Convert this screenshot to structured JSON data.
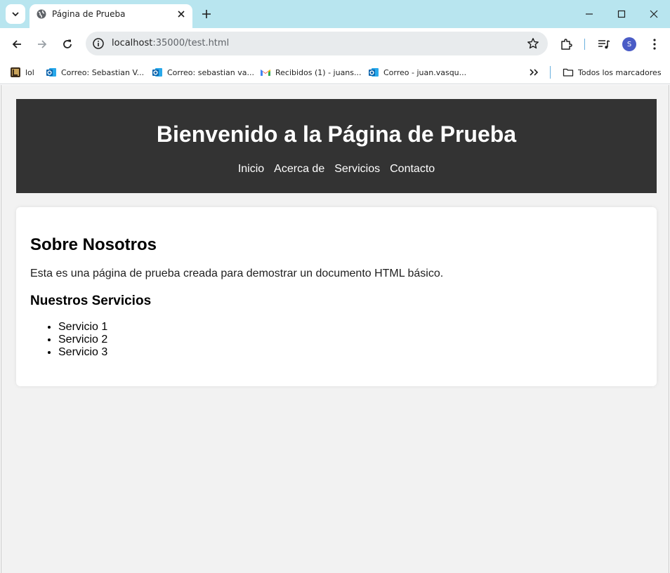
{
  "browser": {
    "tab": {
      "title": "Página de Prueba"
    },
    "address": {
      "host": "localhost",
      "rest": ":35000/test.html"
    },
    "avatar_letter": "S",
    "bookmarks": [
      {
        "label": "lol",
        "icon": "lol-bookmark-icon"
      },
      {
        "label": "Correo: Sebastian V...",
        "icon": "outlook-icon"
      },
      {
        "label": "Correo: sebastian va...",
        "icon": "outlook-icon"
      },
      {
        "label": "Recibidos (1) - juans...",
        "icon": "gmail-icon"
      },
      {
        "label": "Correo - juan.vasqu...",
        "icon": "outlook-icon"
      }
    ],
    "all_bookmarks_label": "Todos los marcadores",
    "colors": {
      "tabstrip": "#b8e5ef",
      "omnibox": "#e8ebed",
      "avatar": "#4a5cc6"
    }
  },
  "page": {
    "header": {
      "title": "Bienvenido a la Página de Prueba",
      "nav": [
        "Inicio",
        "Acerca de",
        "Servicios",
        "Contacto"
      ]
    },
    "about": {
      "heading": "Sobre Nosotros",
      "text": "Esta es una página de prueba creada para demostrar un documento HTML básico."
    },
    "services": {
      "heading": "Nuestros Servicios",
      "items": [
        "Servicio 1",
        "Servicio 2",
        "Servicio 3"
      ]
    },
    "colors": {
      "header_bg": "#333333",
      "page_bg": "#f2f2f2",
      "card_bg": "#ffffff"
    }
  }
}
